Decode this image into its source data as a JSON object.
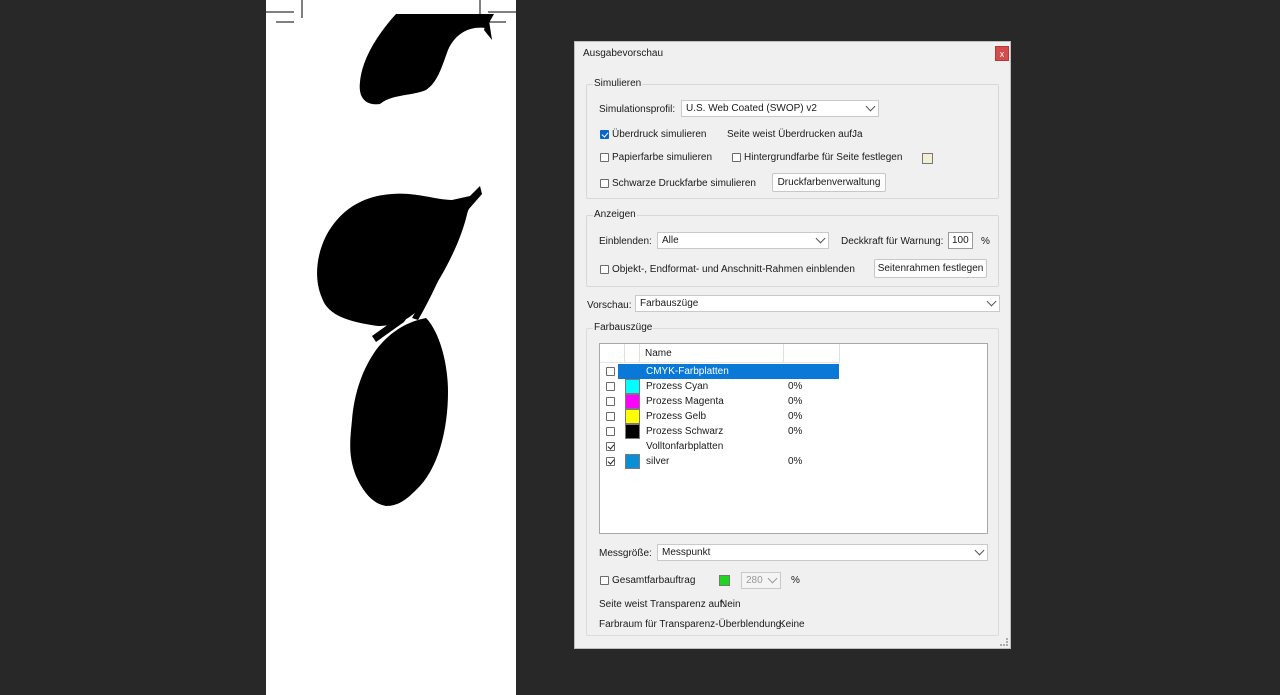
{
  "dialog": {
    "title": "Ausgabevorschau",
    "close_label": "x",
    "simulate": {
      "legend": "Simulieren",
      "profile_label": "Simulationsprofil:",
      "profile_value": "U.S. Web Coated (SWOP) v2",
      "overprint_label": "Überdruck simulieren",
      "overprint_checked": true,
      "page_overprint_label": "Seite weist Überdrucken auf:",
      "page_overprint_value": "Ja",
      "paper_label": "Papierfarbe simulieren",
      "bg_label": "Hintergrundfarbe für Seite festlegen",
      "black_label": "Schwarze Druckfarbe simulieren",
      "ink_manager_button": "Druckfarbenverwaltung"
    },
    "show": {
      "legend": "Anzeigen",
      "show_label": "Einblenden:",
      "show_value": "Alle",
      "opacity_label": "Deckkraft für Warnung:",
      "opacity_value": "100",
      "opacity_unit": "%",
      "boxes_label": "Objekt-, Endformat- und Anschnitt-Rahmen einblenden",
      "page_boxes_button": "Seitenrahmen festlegen"
    },
    "preview": {
      "label": "Vorschau:",
      "value": "Farbauszüge"
    },
    "separations": {
      "legend": "Farbauszüge",
      "header_name": "Name",
      "rows": [
        {
          "name": "CMYK-Farbplatten",
          "checked": false,
          "color": "",
          "pct": "",
          "selected": true
        },
        {
          "name": "Prozess Cyan",
          "checked": false,
          "color": "#00ffff",
          "pct": "0%"
        },
        {
          "name": "Prozess Magenta",
          "checked": false,
          "color": "#ff00ff",
          "pct": "0%"
        },
        {
          "name": "Prozess Gelb",
          "checked": false,
          "color": "#ffff00",
          "pct": "0%"
        },
        {
          "name": "Prozess Schwarz",
          "checked": false,
          "color": "#000000",
          "pct": "0%"
        },
        {
          "name": "Volltonfarbplatten",
          "checked": true,
          "color": "",
          "pct": ""
        },
        {
          "name": "silver",
          "checked": true,
          "color": "#0a8fd6",
          "pct": "0%"
        }
      ],
      "sample_label": "Messgröße:",
      "sample_value": "Messpunkt",
      "total_label": "Gesamtfarbauftrag",
      "total_color": "#1fd61f",
      "total_value": "280",
      "total_unit": "%",
      "transparency_label": "Seite weist Transparenz auf:",
      "transparency_value": "Nein",
      "blend_label": "Farbraum für Transparenz-Überblendung:",
      "blend_value": "Keine"
    }
  }
}
